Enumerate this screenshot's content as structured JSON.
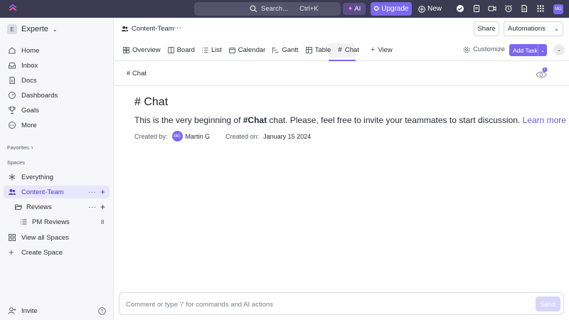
{
  "topbar": {
    "search_label": "Search...",
    "search_shortcut": "Ctrl+K",
    "ai_label": "AI",
    "upgrade_label": "Upgrade",
    "new_label": "New",
    "avatar_initials": "MG"
  },
  "workspace": {
    "badge": "E",
    "name": "Experte"
  },
  "nav": {
    "home": "Home",
    "inbox": "Inbox",
    "docs": "Docs",
    "dashboards": "Dashboards",
    "goals": "Goals",
    "more": "More"
  },
  "sections": {
    "favorites": "Favorites",
    "spaces": "Spaces"
  },
  "spaces": {
    "everything": "Everything",
    "content_team": "Content-Team",
    "reviews": "Reviews",
    "pm_reviews": "PM Reviews",
    "pm_reviews_count": "8",
    "view_all": "View all Spaces",
    "create": "Create Space"
  },
  "invite_label": "Invite",
  "header": {
    "breadcrumb": "Content-Team",
    "share": "Share",
    "automations": "Automations",
    "customize": "Customize",
    "add_task": "Add Task"
  },
  "views": {
    "overview": "Overview",
    "board": "Board",
    "list": "List",
    "calendar": "Calendar",
    "gantt": "Gantt",
    "table": "Table",
    "chat": "Chat",
    "add_view": "View"
  },
  "subheader": {
    "title": "# Chat",
    "watcher_count": "1"
  },
  "chat": {
    "title": "# Chat",
    "intro_before": "This is the very beginning of ",
    "intro_channel": "#Chat",
    "intro_after": " chat. Please, feel free to invite your teammates to start discussion. ",
    "learn_more": "Learn more",
    "created_by_label": "Created by:",
    "creator_initials": "MG",
    "creator_name": "Martin G",
    "created_on_label": "Created on:",
    "created_on_value": "January 15 2024"
  },
  "composer": {
    "placeholder": "Comment or type '/' for commands and AI actions",
    "send": "Send"
  },
  "colors": {
    "accent": "#7b68ee",
    "topbar": "#3b3b52",
    "active_space_bg": "#e8e6fb"
  }
}
